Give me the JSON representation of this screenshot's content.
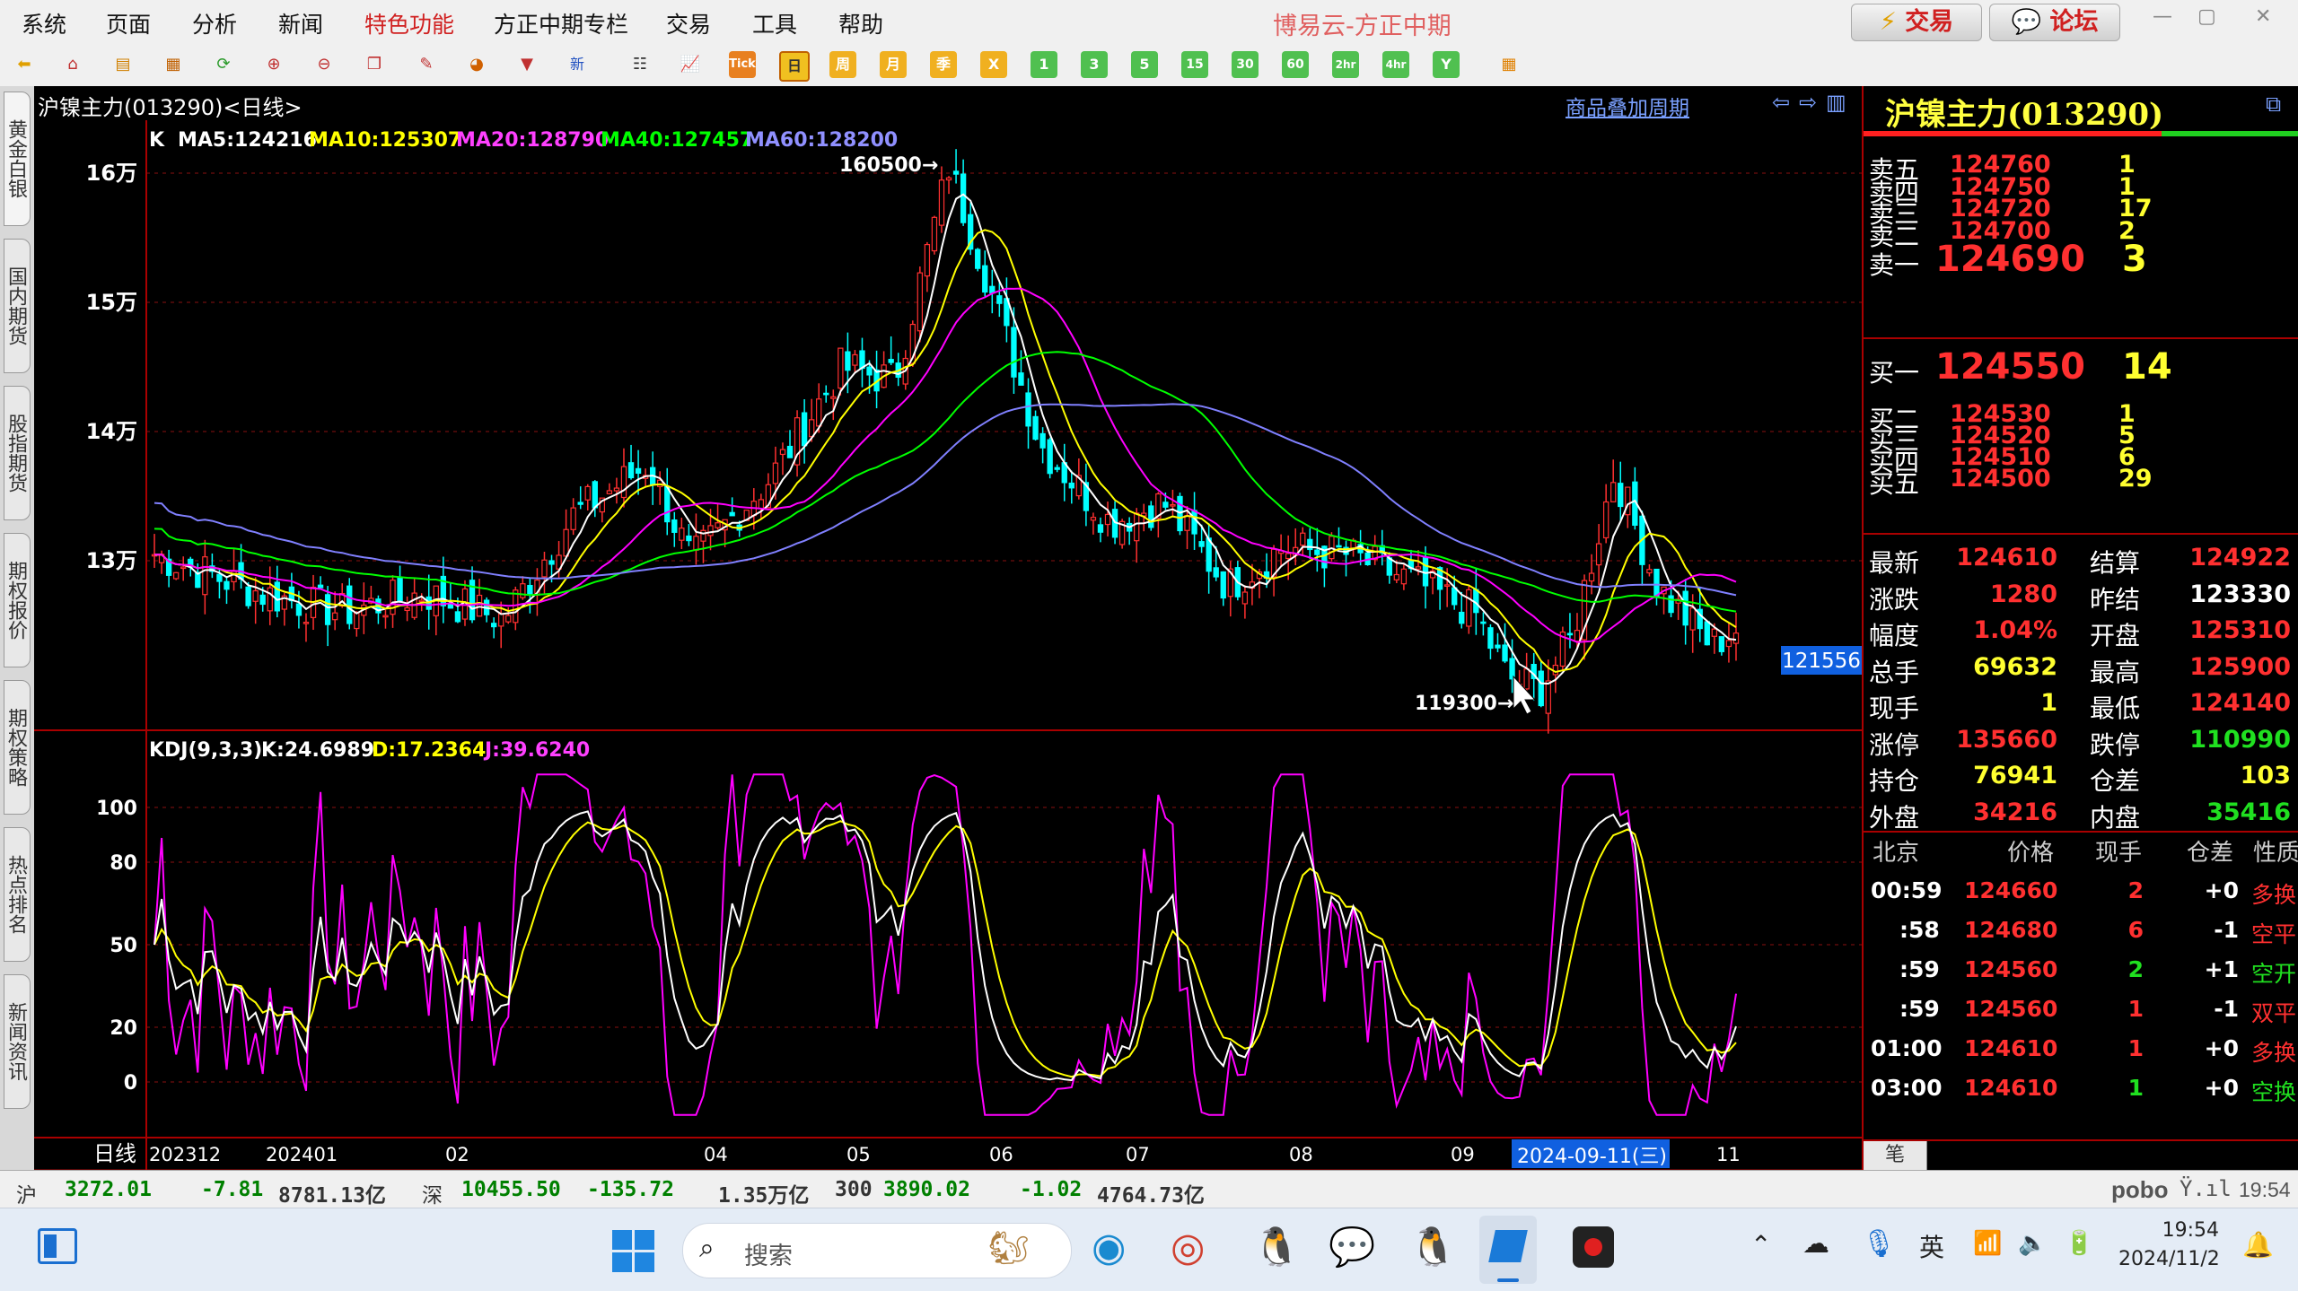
{
  "menu": {
    "items": [
      "系统",
      "页面",
      "分析",
      "新闻",
      "特色功能",
      "方正中期专栏",
      "交易",
      "工具",
      "帮助"
    ],
    "app_title": "博易云-方正中期",
    "trade_button": "交易",
    "forum_button": "论坛"
  },
  "toolbar": {
    "buttons": [
      "Tick",
      "日",
      "周",
      "月",
      "季",
      "X",
      "1",
      "3",
      "5",
      "15",
      "30",
      "60",
      "2hr",
      "4hr",
      "Y"
    ],
    "new_label": "新"
  },
  "left_tabs": [
    "黄金白银",
    "国内期货",
    "股指期货",
    "期权报价",
    "期权策略",
    "热点排名",
    "新闻资讯"
  ],
  "chart": {
    "title": "沪镍主力(013290)<日线>",
    "overlay_link": "商品叠加",
    "period_link": "周期",
    "ma_legend": {
      "k": "K",
      "ma5": "MA5:124216",
      "ma10": "MA10:125307",
      "ma20": "MA20:128790",
      "ma40": "MA40:127457",
      "ma60": "MA60:128200"
    },
    "price_axis": [
      "16万",
      "15万",
      "14万",
      "13万"
    ],
    "high_marker": "160500",
    "low_marker": "119300",
    "current_price_tag": "121556",
    "kdj_legend": {
      "name": "KDJ(9,3,3)",
      "k": "K:24.6989",
      "d": "D:17.2364",
      "j": "J:39.6240"
    },
    "kdj_axis": [
      "100",
      "80",
      "50",
      "20",
      "0"
    ],
    "x_axis_label": "日线",
    "x_axis": [
      "202312",
      "202401",
      "02",
      "04",
      "05",
      "06",
      "07",
      "08",
      "09",
      "11"
    ],
    "x_cursor_label": "2024-09-11(三)"
  },
  "colors": {
    "ma5": "#ffffff",
    "ma10": "#ffff00",
    "ma20": "#ff00ff",
    "ma40": "#00ff00",
    "ma60": "#8080ff",
    "up": "#ff3030",
    "down": "#00ffff",
    "kdj_k": "#ffffff",
    "kdj_d": "#ffff00",
    "kdj_j": "#ff00ff"
  },
  "quote": {
    "title": "沪镍主力(013290)",
    "asks": [
      {
        "label": "卖五",
        "price": "124760",
        "vol": "1"
      },
      {
        "label": "卖四",
        "price": "124750",
        "vol": "1"
      },
      {
        "label": "卖三",
        "price": "124720",
        "vol": "17"
      },
      {
        "label": "卖二",
        "price": "124700",
        "vol": "2"
      },
      {
        "label": "卖一",
        "price": "124690",
        "vol": "3"
      }
    ],
    "bids": [
      {
        "label": "买一",
        "price": "124550",
        "vol": "14"
      },
      {
        "label": "买二",
        "price": "124530",
        "vol": "1"
      },
      {
        "label": "买三",
        "price": "124520",
        "vol": "5"
      },
      {
        "label": "买四",
        "price": "124510",
        "vol": "6"
      },
      {
        "label": "买五",
        "price": "124500",
        "vol": "29"
      }
    ],
    "stats": [
      {
        "l1": "最新",
        "v1": "124610",
        "l2": "结算",
        "v2": "124922"
      },
      {
        "l1": "涨跌",
        "v1": "1280",
        "l2": "昨结",
        "v2": "123330"
      },
      {
        "l1": "幅度",
        "v1": "1.04%",
        "l2": "开盘",
        "v2": "125310"
      },
      {
        "l1": "总手",
        "v1": "69632",
        "l2": "最高",
        "v2": "125900"
      },
      {
        "l1": "现手",
        "v1": "1",
        "l2": "最低",
        "v2": "124140"
      },
      {
        "l1": "涨停",
        "v1": "135660",
        "l2": "跌停",
        "v2": "110990"
      },
      {
        "l1": "持仓",
        "v1": "76941",
        "l2": "仓差",
        "v2": "103"
      },
      {
        "l1": "外盘",
        "v1": "34216",
        "l2": "内盘",
        "v2": "35416"
      }
    ],
    "ticks_header": [
      "北京",
      "价格",
      "现手",
      "仓差",
      "性质"
    ],
    "ticks": [
      {
        "time": "00:59",
        "price": "124660",
        "vol": "2",
        "oi": "+0",
        "type": "多换"
      },
      {
        "time": ":58",
        "price": "124680",
        "vol": "6",
        "oi": "-1",
        "type": "空平"
      },
      {
        "time": ":59",
        "price": "124560",
        "vol": "2",
        "oi": "+1",
        "type": "空开"
      },
      {
        "time": ":59",
        "price": "124560",
        "vol": "1",
        "oi": "-1",
        "type": "双平"
      },
      {
        "time": "01:00",
        "price": "124610",
        "vol": "1",
        "oi": "+0",
        "type": "多换"
      },
      {
        "time": "03:00",
        "price": "124610",
        "vol": "1",
        "oi": "+0",
        "type": "空换"
      }
    ],
    "footer_tab": "笔"
  },
  "status": {
    "sh_label": "沪",
    "sh_index": "3272.01",
    "sh_change": "-7.81",
    "sh_amount": "8781.13亿",
    "sz_label": "深",
    "sz_index": "10455.50",
    "sz_change": "-135.72",
    "sz_amount": "1.35万亿",
    "hs300_label": "300",
    "hs300_index": "3890.02",
    "hs300_change": "-1.02",
    "hs300_amount": "4764.73亿",
    "brand": "pobo",
    "time": "19:54"
  },
  "taskbar": {
    "search_placeholder": "搜索",
    "ime": "英",
    "clock_time": "19:54",
    "clock_date": "2024/11/2"
  }
}
